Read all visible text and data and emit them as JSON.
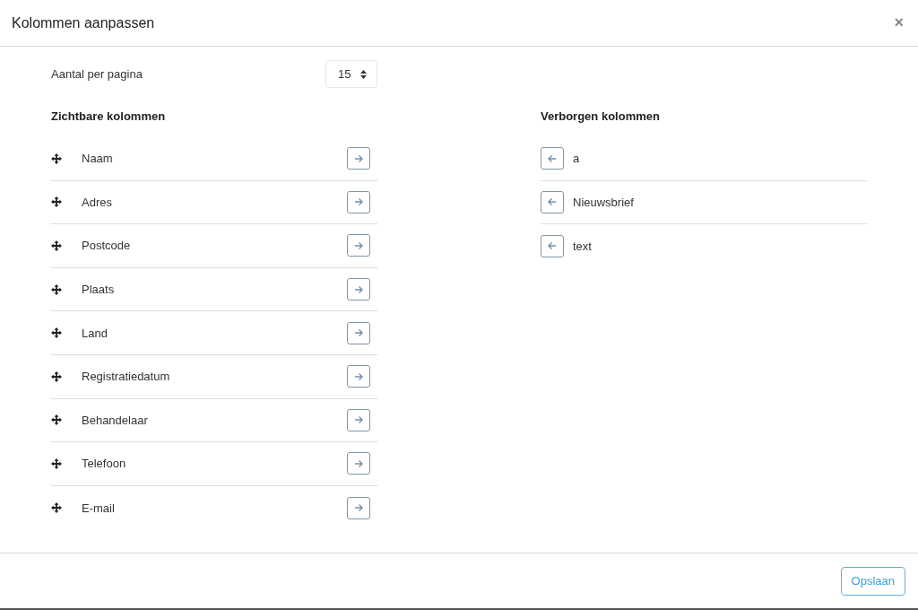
{
  "dialog": {
    "title": "Kolommen aanpassen",
    "close": "×"
  },
  "per_page": {
    "label": "Aantal per pagina",
    "value": "15"
  },
  "visible_columns": {
    "heading": "Zichtbare kolommen",
    "items": [
      {
        "label": "Naam"
      },
      {
        "label": "Adres"
      },
      {
        "label": "Postcode"
      },
      {
        "label": "Plaats"
      },
      {
        "label": "Land"
      },
      {
        "label": "Registratiedatum"
      },
      {
        "label": "Behandelaar"
      },
      {
        "label": "Telefoon"
      },
      {
        "label": "E-mail"
      }
    ]
  },
  "hidden_columns": {
    "heading": "Verborgen kolommen",
    "items": [
      {
        "label": "a"
      },
      {
        "label": "Nieuwsbrief"
      },
      {
        "label": "text"
      }
    ]
  },
  "footer": {
    "save_button": "Opslaan"
  }
}
